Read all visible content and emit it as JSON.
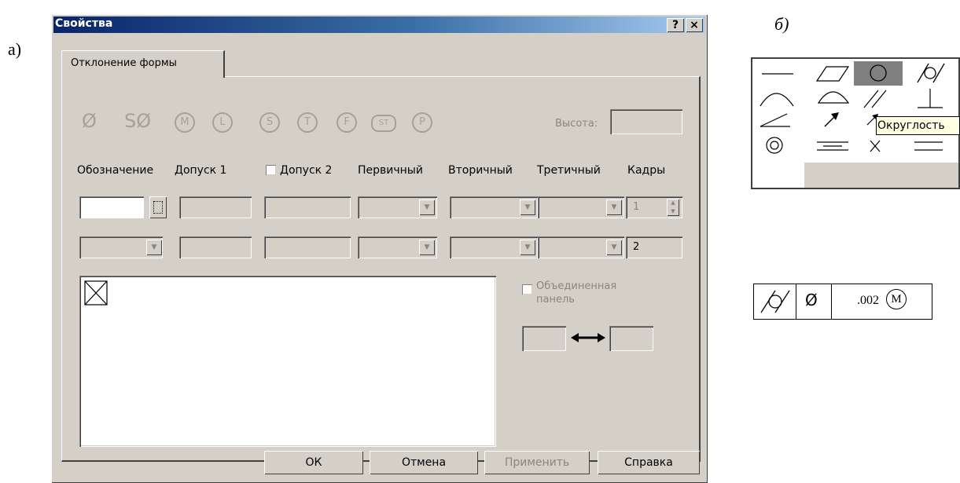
{
  "labels": {
    "a": "а)",
    "b": "б)"
  },
  "dialog": {
    "title": "Свойства",
    "help_button": "?",
    "close_button": "×",
    "tab": "Отклонение формы",
    "symbols": [
      "Ø",
      "SØ",
      "M",
      "L",
      "S",
      "T",
      "F",
      "ST",
      "P"
    ],
    "height_label": "Высота:",
    "columns": {
      "designation": "Обозначение",
      "tolerance1": "Допуск 1",
      "tolerance2": "Допуск 2",
      "primary": "Первичный",
      "secondary": "Вторичный",
      "tertiary": "Третичный",
      "frames": "Кадры"
    },
    "frames_value_row1": "1",
    "frames_value_row2": "2",
    "combined_panel_label_1": "Объединенная",
    "combined_panel_label_2": "панель",
    "buttons": {
      "ok": "ОК",
      "cancel": "Отмена",
      "apply": "Применить",
      "help": "Справка"
    }
  },
  "palette": {
    "tooltip": "Округлость"
  },
  "frame_example": {
    "diameter": "Ø",
    "value": ".002",
    "modifier": "M"
  },
  "colors": {
    "titlebar_start": "#0a246a",
    "titlebar_end": "#a6caf0",
    "dialog_bg": "#d4d0c8",
    "tooltip_bg": "#ffffe1"
  }
}
